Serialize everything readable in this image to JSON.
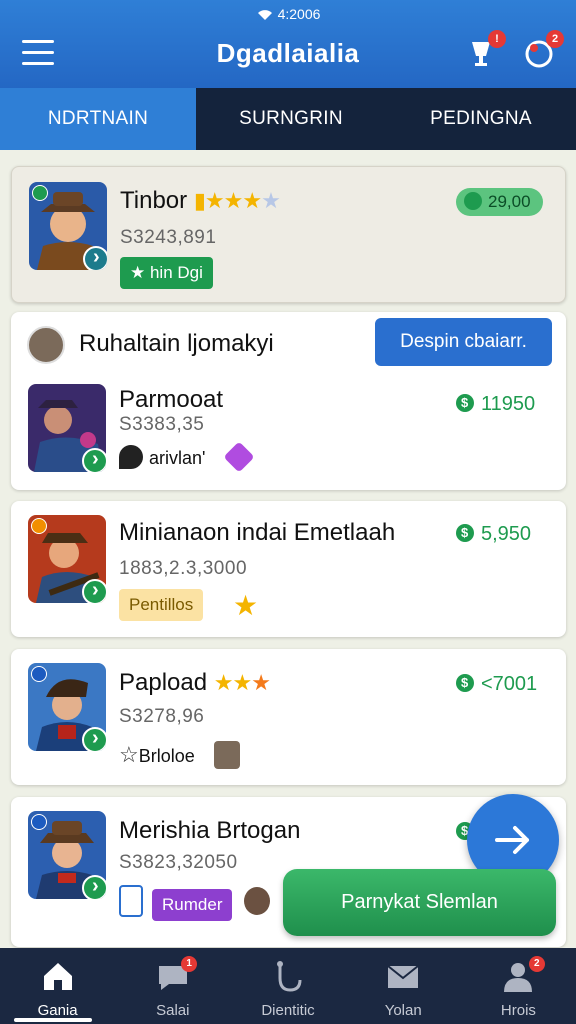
{
  "status": {
    "time": "4:2006"
  },
  "header": {
    "title": "Dgadlaialia",
    "notification_badge": "!",
    "alert_badge": "2"
  },
  "tabs": [
    {
      "label": "NDRTNAIN",
      "active": true
    },
    {
      "label": "SURNGRIN",
      "active": false
    },
    {
      "label": "PEDINGNA",
      "active": false
    }
  ],
  "featured": {
    "name": "Tinbor",
    "sub": "S3243,891",
    "price": "29,00",
    "tag": "hin Dgi",
    "rating": 4
  },
  "section": {
    "title": "Ruhaltain ljomakyi",
    "button": "Despin cbaiarr.",
    "item": {
      "name": "Parmooat",
      "sub": "S3383,35",
      "price": "11950",
      "tag": "arivlan'"
    }
  },
  "items": [
    {
      "name": "Minianaon indai Emetlaah",
      "sub": "1883,2.3,3000",
      "price": "5,950",
      "tag": "Pentillos",
      "rating": 1
    },
    {
      "name": "Papload",
      "sub": "S3278,96",
      "price": "<7001",
      "tag": "Brloloe",
      "rating": 3
    },
    {
      "name": "Merishia Brtogan",
      "sub": "S3823,32050",
      "price": "",
      "tag": "Rumder"
    }
  ],
  "cta": {
    "label": "Parnykat Slemlan"
  },
  "bottomnav": [
    {
      "label": "Gania",
      "icon": "home-icon",
      "active": true
    },
    {
      "label": "Salai",
      "icon": "chat-icon",
      "badge": "1"
    },
    {
      "label": "Dientitic",
      "icon": "tools-icon"
    },
    {
      "label": "Yolan",
      "icon": "mail-icon"
    },
    {
      "label": "Hrois",
      "icon": "profile-icon",
      "badge": "2"
    }
  ],
  "colors": {
    "primary": "#2f7fd6",
    "nav_dark": "#14233c",
    "green": "#1e9b4f",
    "gold": "#f4b400"
  }
}
